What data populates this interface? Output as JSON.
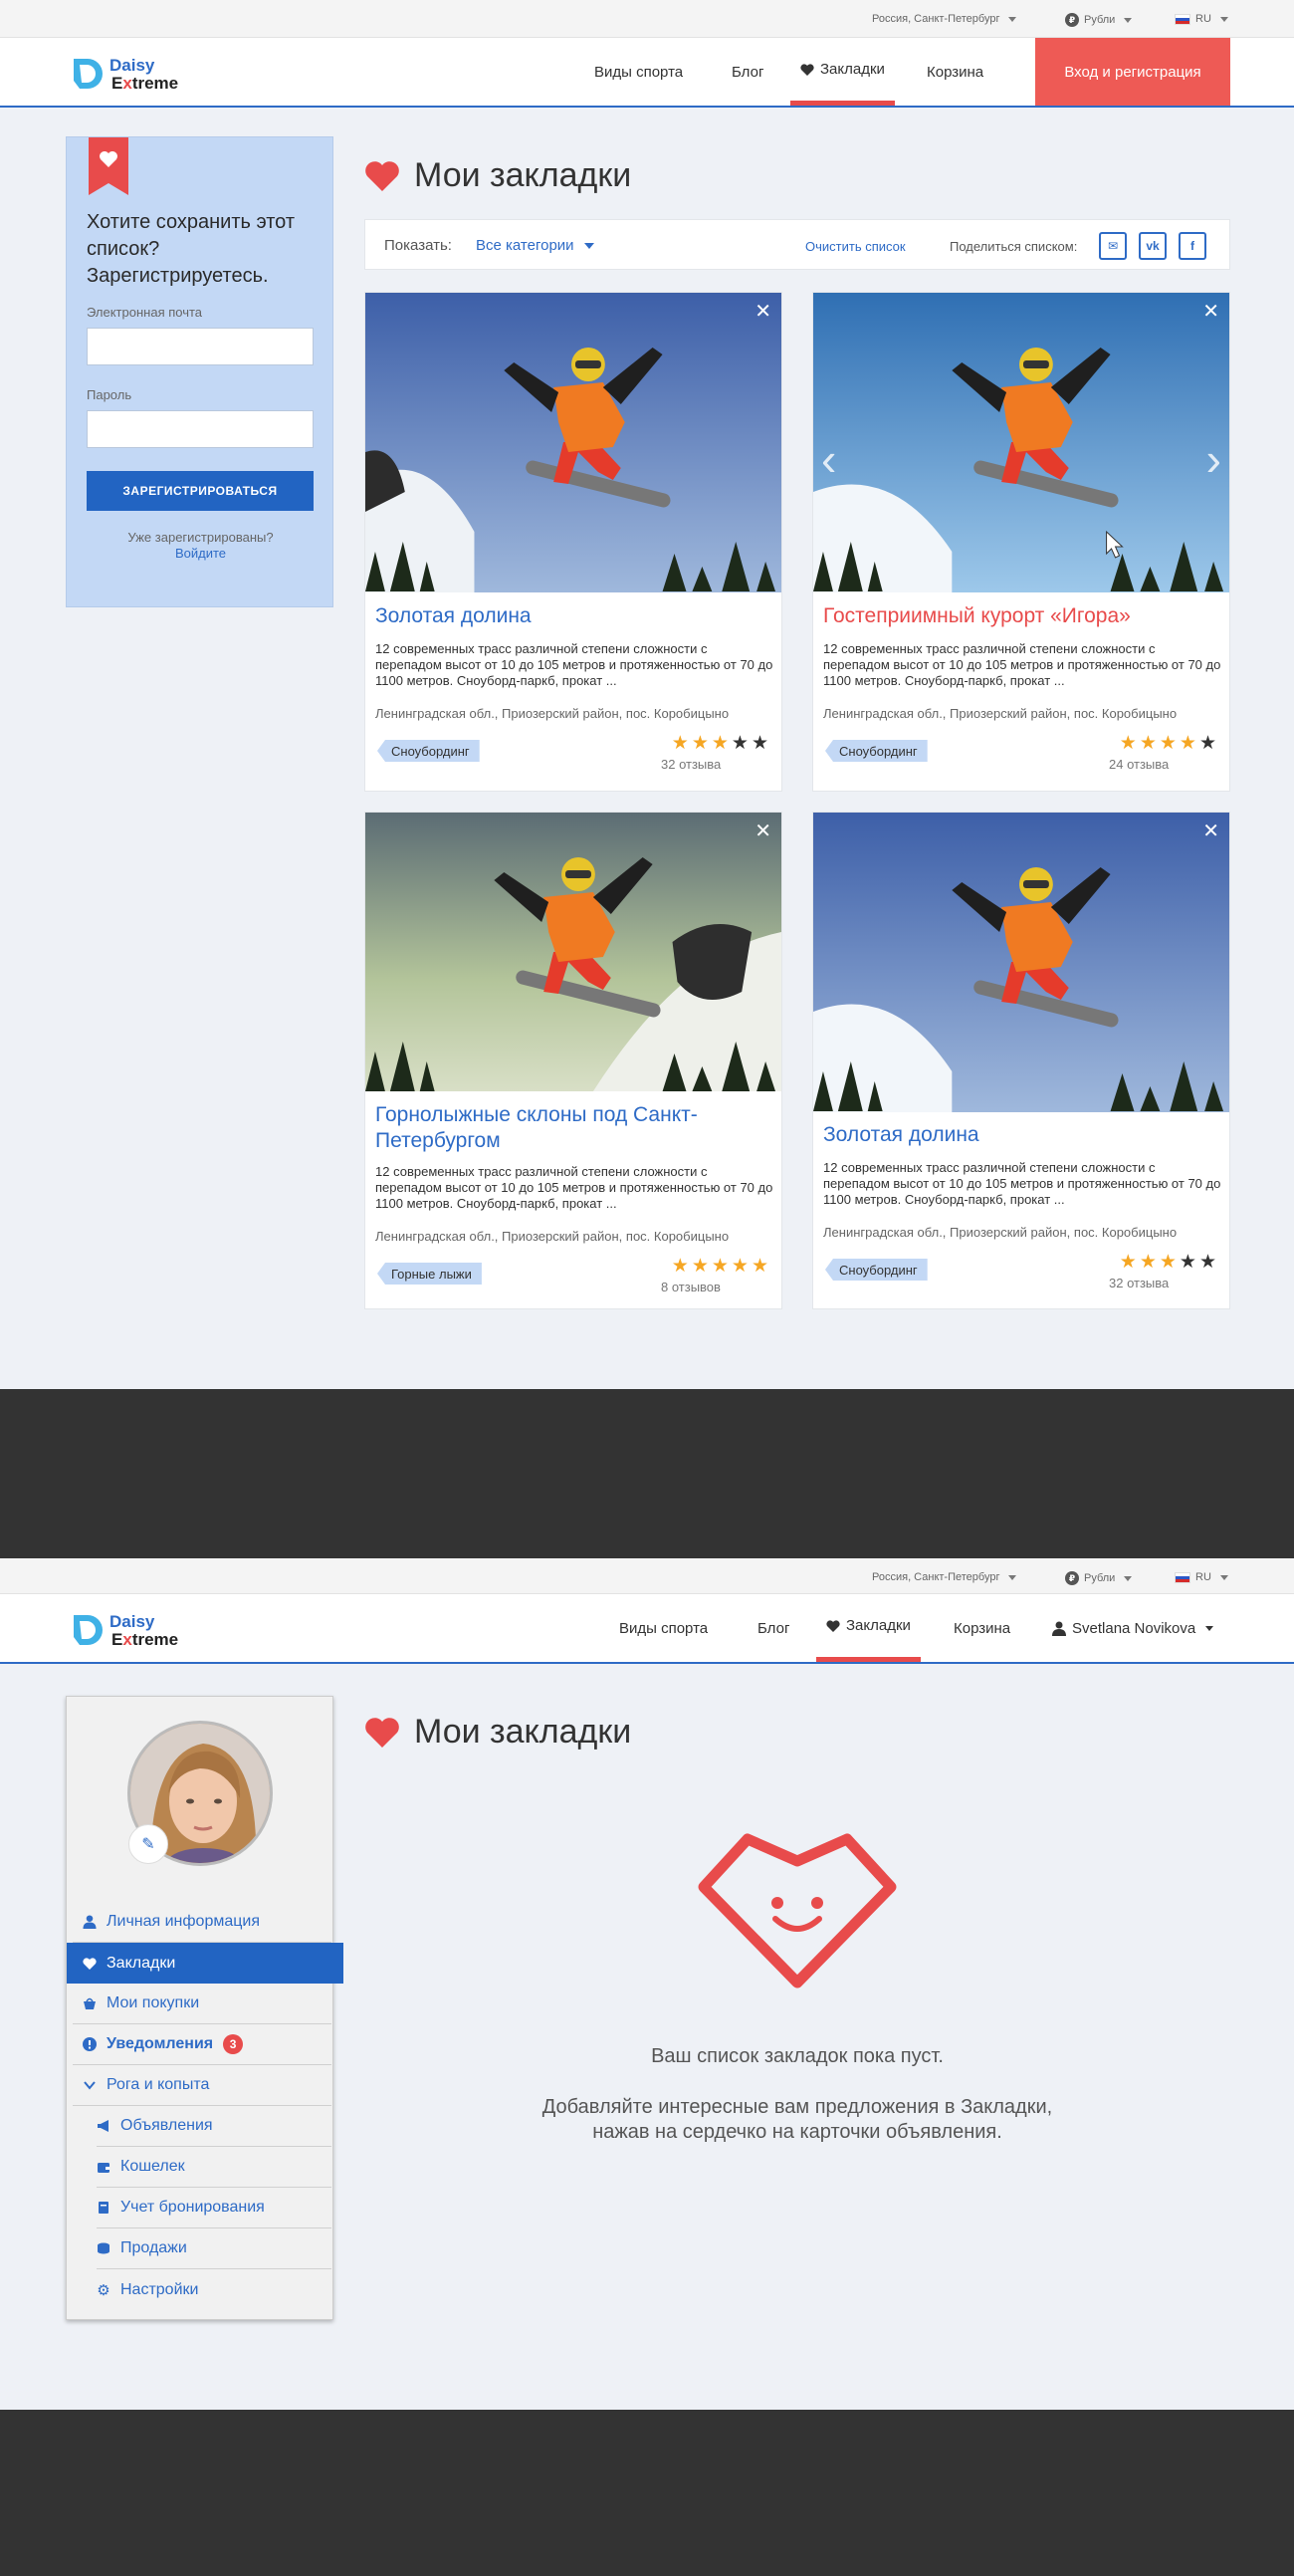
{
  "topbar": {
    "region": "Россия, Санкт-Петербург",
    "currency_icon": "₽",
    "currency": "Рубли",
    "lang": "RU"
  },
  "logo": {
    "line1": "Daisy",
    "line2_pre": "E",
    "line2_mid": "x",
    "line2_post": "treme"
  },
  "nav": {
    "sports": "Виды спорта",
    "blog": "Блог",
    "bookmarks": "Закладки",
    "cart": "Корзина",
    "login": "Вход и регистрация",
    "user": "Svetlana Novikova"
  },
  "page": {
    "title": "Мои закладки"
  },
  "register_box": {
    "question": "Хотите сохранить этот список? Зарегистрируетесь.",
    "email_label": "Электронная почта",
    "password_label": "Пароль",
    "button": "ЗАРЕГИСТРИРОВАТЬСЯ",
    "already": "Уже зарегистрированы?",
    "login_link": "Войдите"
  },
  "filter": {
    "show_label": "Показать:",
    "category": "Все категории",
    "clear": "Очистить список",
    "share_label": "Поделиться списком:",
    "share_icons": [
      "mail-icon",
      "vk-icon",
      "facebook-icon"
    ]
  },
  "cards": [
    {
      "title": "Золотая долина",
      "desc": "12 современных трасс различной степени сложности с перепадом высот от 10 до 105 метров и протяженностью от 70 до 1100 метров. Сноуборд-паркб, прокат ...",
      "location": "Ленинградская обл., Приозерский район, пос. Коробицыно",
      "tag": "Сноубординг",
      "rating": 3,
      "reviews": "32 отзыва"
    },
    {
      "title": "Гостеприимный курорт «Игора»",
      "desc": "12 современных трасс различной степени сложности с перепадом высот от 10 до 105 метров и протяженностью от 70 до 1100 метров. Сноуборд-паркб, прокат ...",
      "location": "Ленинградская обл., Приозерский район, пос. Коробицыно",
      "tag": "Сноубординг",
      "rating": 4,
      "reviews": "24 отзыва"
    },
    {
      "title": "Горнолыжные склоны под Санкт-Петербургом",
      "desc": "12 современных трасс различной степени сложности с перепадом высот от 10 до 105 метров и протяженностью от 70 до 1100 метров. Сноуборд-паркб, прокат ...",
      "location": "Ленинградская обл., Приозерский район, пос. Коробицыно",
      "tag": "Горные лыжи",
      "rating": 5,
      "reviews": "8 отзывов"
    },
    {
      "title": "Золотая долина",
      "desc": "12 современных трасс различной степени сложности с перепадом высот от 10 до 105 метров и протяженностью от 70 до 1100 метров. Сноуборд-паркб, прокат ...",
      "location": "Ленинградская обл., Приозерский район, пос. Коробицыно",
      "tag": "Сноубординг",
      "rating": 3,
      "reviews": "32 отзыва"
    }
  ],
  "profile_menu": [
    {
      "label": "Личная информация",
      "icon": "user-icon"
    },
    {
      "label": "Закладки",
      "icon": "heart-icon"
    },
    {
      "label": "Мои покупки",
      "icon": "basket-icon"
    },
    {
      "label": "Уведомления",
      "icon": "alert-icon",
      "badge": "3"
    },
    {
      "label": "Рога и копыта",
      "icon": "chevron-down-icon"
    },
    {
      "label": "Объявления",
      "icon": "megaphone-icon"
    },
    {
      "label": "Кошелек",
      "icon": "wallet-icon"
    },
    {
      "label": "Учет бронирования",
      "icon": "book-icon"
    },
    {
      "label": "Продажи",
      "icon": "coins-icon"
    },
    {
      "label": "Настройки",
      "icon": "gear-icon"
    }
  ],
  "empty": {
    "line1": "Ваш список закладок пока пуст.",
    "line2": "Добавляйте интересные вам предложения в Закладки,",
    "line3": "нажав на сердечко на карточки объявления."
  },
  "colors": {
    "accent": "#2e6bc6",
    "brand_red": "#e84b4b",
    "star": "#f5a623",
    "footer": "#333333"
  }
}
